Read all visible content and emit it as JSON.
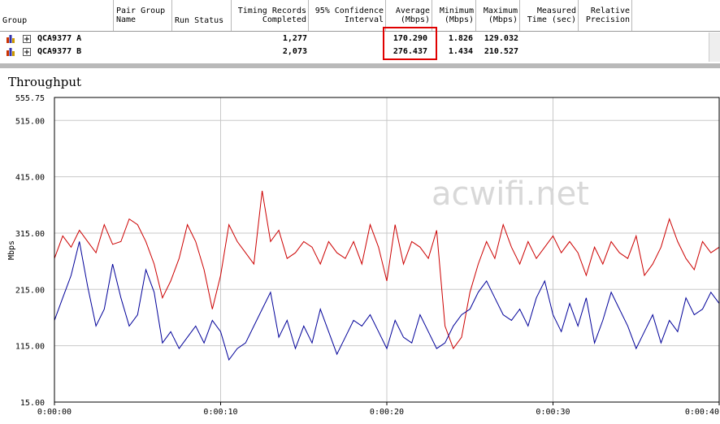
{
  "table": {
    "headers": [
      {
        "id": "group",
        "label": "Group"
      },
      {
        "id": "pair_group_name",
        "label": "Pair Group\nName"
      },
      {
        "id": "run_status",
        "label": "Run Status"
      },
      {
        "id": "timing_records",
        "label": "Timing Records\nCompleted"
      },
      {
        "id": "confidence",
        "label": "95% Confidence\nInterval"
      },
      {
        "id": "average",
        "label": "Average\n(Mbps)"
      },
      {
        "id": "minimum",
        "label": "Minimum\n(Mbps)"
      },
      {
        "id": "maximum",
        "label": "Maximum\n(Mbps)"
      },
      {
        "id": "measured_time",
        "label": "Measured\nTime (sec)"
      },
      {
        "id": "relative_precision",
        "label": "Relative\nPrecision"
      }
    ],
    "rows": [
      {
        "name": "QCA9377 A",
        "records": "1,277",
        "average": "170.290",
        "minimum": "1.826",
        "maximum": "129.032"
      },
      {
        "name": "QCA9377 B",
        "records": "2,073",
        "average": "276.437",
        "minimum": "1.434",
        "maximum": "210.527"
      }
    ]
  },
  "watermark": "acwifi.net",
  "chart_data": {
    "type": "line",
    "title": "Throughput",
    "ylabel": "Mbps",
    "xlabel": "",
    "ylim": [
      15.0,
      555.75
    ],
    "yticks": [
      "555.75",
      "515.00",
      "415.00",
      "315.00",
      "215.00",
      "115.00",
      "15.00"
    ],
    "ytick_values": [
      555.75,
      515,
      415,
      315,
      215,
      115,
      15
    ],
    "xlim": [
      0,
      40
    ],
    "xticks": [
      "0:00:00",
      "0:00:10",
      "0:00:20",
      "0:00:30",
      "0:00:40"
    ],
    "xtick_values": [
      0,
      10,
      20,
      30,
      40
    ],
    "grid": true,
    "series": [
      {
        "color": "#cc0000",
        "x": [
          0,
          0.5,
          1,
          1.5,
          2,
          2.5,
          3,
          3.5,
          4,
          4.5,
          5,
          5.5,
          6,
          6.5,
          7,
          7.5,
          8,
          8.5,
          9,
          9.5,
          10,
          10.5,
          11,
          11.5,
          12,
          12.5,
          13,
          13.5,
          14,
          14.5,
          15,
          15.5,
          16,
          16.5,
          17,
          17.5,
          18,
          18.5,
          19,
          19.5,
          20,
          20.5,
          21,
          21.5,
          22,
          22.5,
          23,
          23.5,
          24,
          24.5,
          25,
          25.5,
          26,
          26.5,
          27,
          27.5,
          28,
          28.5,
          29,
          29.5,
          30,
          30.5,
          31,
          31.5,
          32,
          32.5,
          33,
          33.5,
          34,
          34.5,
          35,
          35.5,
          36,
          36.5,
          37,
          37.5,
          38,
          38.5,
          39,
          39.5,
          40
        ],
        "values": [
          270,
          310,
          290,
          320,
          300,
          280,
          330,
          295,
          300,
          340,
          330,
          300,
          260,
          200,
          230,
          270,
          330,
          300,
          250,
          180,
          240,
          330,
          300,
          280,
          260,
          390,
          300,
          320,
          270,
          280,
          300,
          290,
          260,
          300,
          280,
          270,
          300,
          260,
          330,
          290,
          230,
          330,
          260,
          300,
          290,
          270,
          320,
          150,
          110,
          130,
          210,
          260,
          300,
          270,
          330,
          290,
          260,
          300,
          270,
          290,
          310,
          280,
          300,
          280,
          240,
          290,
          260,
          300,
          280,
          270,
          310,
          240,
          260,
          290,
          340,
          300,
          270,
          250,
          300,
          280,
          290
        ]
      },
      {
        "color": "#000099",
        "x": [
          0,
          0.5,
          1,
          1.5,
          2,
          2.5,
          3,
          3.5,
          4,
          4.5,
          5,
          5.5,
          6,
          6.5,
          7,
          7.5,
          8,
          8.5,
          9,
          9.5,
          10,
          10.5,
          11,
          11.5,
          12,
          12.5,
          13,
          13.5,
          14,
          14.5,
          15,
          15.5,
          16,
          16.5,
          17,
          17.5,
          18,
          18.5,
          19,
          19.5,
          20,
          20.5,
          21,
          21.5,
          22,
          22.5,
          23,
          23.5,
          24,
          24.5,
          25,
          25.5,
          26,
          26.5,
          27,
          27.5,
          28,
          28.5,
          29,
          29.5,
          30,
          30.5,
          31,
          31.5,
          32,
          32.5,
          33,
          33.5,
          34,
          34.5,
          35,
          35.5,
          36,
          36.5,
          37,
          37.5,
          38,
          38.5,
          39,
          39.5,
          40
        ],
        "values": [
          160,
          200,
          240,
          300,
          220,
          150,
          180,
          260,
          200,
          150,
          170,
          250,
          210,
          120,
          140,
          110,
          130,
          150,
          120,
          160,
          140,
          90,
          110,
          120,
          150,
          180,
          210,
          130,
          160,
          110,
          150,
          120,
          180,
          140,
          100,
          130,
          160,
          150,
          170,
          140,
          110,
          160,
          130,
          120,
          170,
          140,
          110,
          120,
          150,
          170,
          180,
          210,
          230,
          200,
          170,
          160,
          180,
          150,
          200,
          230,
          170,
          140,
          190,
          150,
          200,
          120,
          160,
          210,
          180,
          150,
          110,
          140,
          170,
          120,
          160,
          140,
          200,
          170,
          180,
          210,
          190
        ]
      }
    ]
  }
}
